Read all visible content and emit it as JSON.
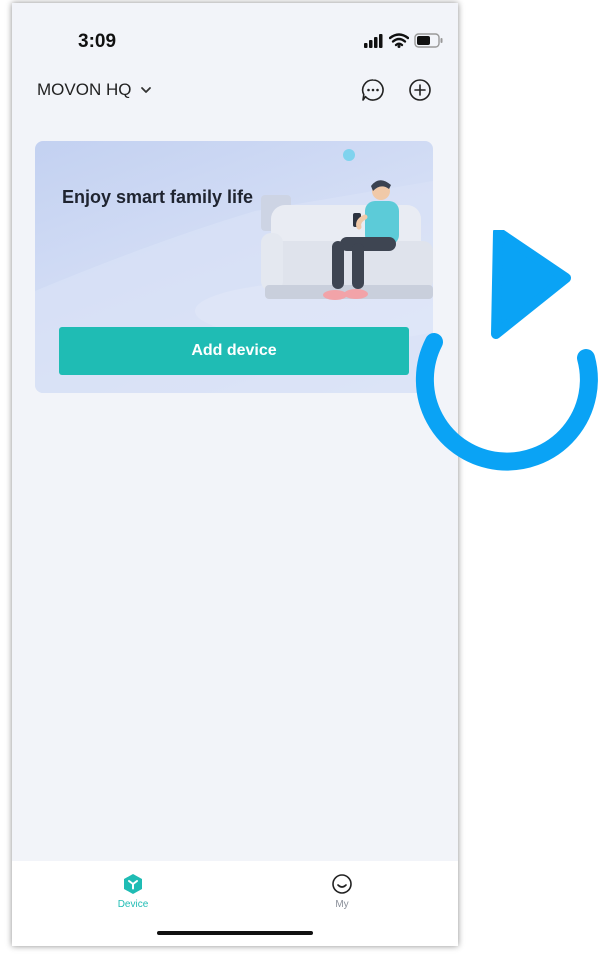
{
  "status_bar": {
    "time": "3:09",
    "icons": [
      "cellular-signal-icon",
      "wifi-icon",
      "battery-icon"
    ]
  },
  "header": {
    "location": "MOVON HQ",
    "icons": [
      "chevron-down-icon",
      "message-icon",
      "add-circle-icon"
    ]
  },
  "banner": {
    "title": "Enjoy smart family life",
    "add_device_label": "Add device"
  },
  "tab_bar": {
    "tabs": [
      {
        "label": "Device",
        "icon": "device-hex-icon",
        "active": true
      },
      {
        "label": "My",
        "icon": "smiley-icon",
        "active": false
      }
    ]
  },
  "overlay": {
    "icon": "refresh-arrow-icon",
    "color": "#0aa3f5"
  },
  "colors": {
    "accent": "#1fbcb4",
    "background": "#f2f4f9",
    "refresh_arrow": "#0aa3f5"
  }
}
